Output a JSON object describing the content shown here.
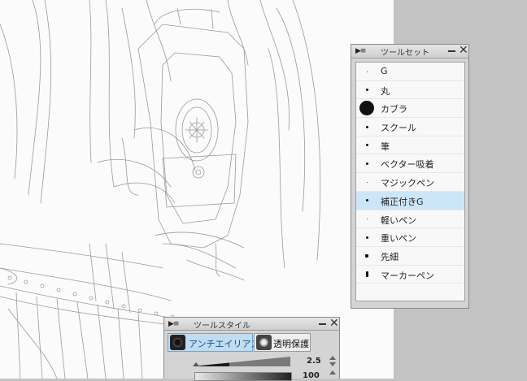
{
  "tool_set_panel": {
    "title": "ツールセット",
    "tools": [
      {
        "label": "G",
        "brush_size": 1,
        "selected": false
      },
      {
        "label": "丸",
        "brush_size": 3,
        "selected": false
      },
      {
        "label": "カブラ",
        "brush_size": 18,
        "selected": false
      },
      {
        "label": "スクール",
        "brush_size": 3,
        "selected": false
      },
      {
        "label": "筆",
        "brush_size": 3,
        "selected": false
      },
      {
        "label": "ベクター吸着",
        "brush_size": 3,
        "selected": false
      },
      {
        "label": "マジックペン",
        "brush_size": 1,
        "selected": false
      },
      {
        "label": "補正付きG",
        "brush_size": 3,
        "selected": true
      },
      {
        "label": "軽いペン",
        "brush_size": 1,
        "selected": false
      },
      {
        "label": "重いペン",
        "brush_size": 3,
        "selected": false
      },
      {
        "label": "先細",
        "brush_size": 4,
        "selected": false
      },
      {
        "label": "マーカーペン",
        "brush_size": 4,
        "selected": false
      }
    ]
  },
  "tool_style_panel": {
    "title": "ツールスタイル",
    "antialias_label": "アンチエイリアス",
    "antialias_active": true,
    "transparency_protect_label": "透明保護",
    "brush_size_value": "2.5",
    "opacity_value": "100"
  },
  "colors": {
    "selection": "#cde6f7",
    "workspace": "#c3c3c3",
    "canvas": "#fbfbfb"
  }
}
